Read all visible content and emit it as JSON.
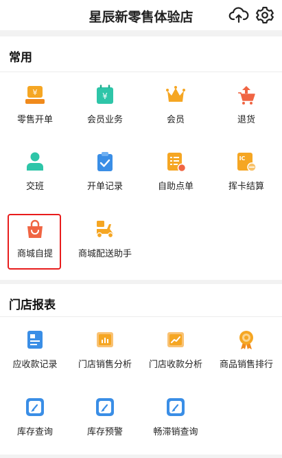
{
  "header": {
    "title": "星辰新零售体验店",
    "icons": [
      "cloud-upload-icon",
      "gear-icon"
    ]
  },
  "sections": [
    {
      "title": "常用",
      "items": [
        {
          "label": "零售开单",
          "icon": "cashier-icon"
        },
        {
          "label": "会员业务",
          "icon": "member-bag-icon"
        },
        {
          "label": "会员",
          "icon": "crown-icon"
        },
        {
          "label": "退货",
          "icon": "return-cart-icon"
        },
        {
          "label": "交班",
          "icon": "person-icon"
        },
        {
          "label": "开单记录",
          "icon": "clipboard-check-icon"
        },
        {
          "label": "自助点单",
          "icon": "menu-list-icon"
        },
        {
          "label": "挥卡结算",
          "icon": "ic-card-icon"
        },
        {
          "label": "商城自提",
          "icon": "shopping-bag-icon"
        },
        {
          "label": "商城配送助手",
          "icon": "scooter-icon"
        }
      ]
    },
    {
      "title": "门店报表",
      "items": [
        {
          "label": "应收款记录",
          "icon": "document-icon"
        },
        {
          "label": "门店销售分析",
          "icon": "bar-chart-icon"
        },
        {
          "label": "门店收款分析",
          "icon": "line-chart-icon"
        },
        {
          "label": "商品销售排行",
          "icon": "medal-icon"
        },
        {
          "label": "库存查询",
          "icon": "pencil-card-icon"
        },
        {
          "label": "库存预警",
          "icon": "pencil-card-icon"
        },
        {
          "label": "畅滞销查询",
          "icon": "pencil-card-icon"
        }
      ]
    }
  ],
  "colors": {
    "orange": "#f5a623",
    "red": "#f06543",
    "teal": "#2ec5a8",
    "blue": "#3a8ee6",
    "highlight_border": "#e81c1c"
  }
}
